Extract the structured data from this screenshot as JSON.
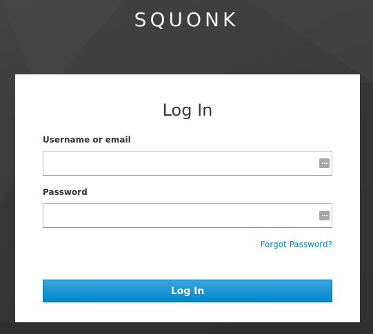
{
  "brand": {
    "title": "SQUONK"
  },
  "login_card": {
    "title": "Log In",
    "username": {
      "label": "Username or email",
      "value": "",
      "placeholder": "",
      "icon": "password-manager-icon"
    },
    "password": {
      "label": "Password",
      "value": "",
      "placeholder": "",
      "icon": "password-manager-icon"
    },
    "forgot_password_link": "Forgot Password?",
    "submit_label": "Log In"
  },
  "colors": {
    "background": "#3a3a3a",
    "card_background": "#ffffff",
    "accent": "#0088ce",
    "link": "#0088ce",
    "button_text": "#ffffff"
  }
}
